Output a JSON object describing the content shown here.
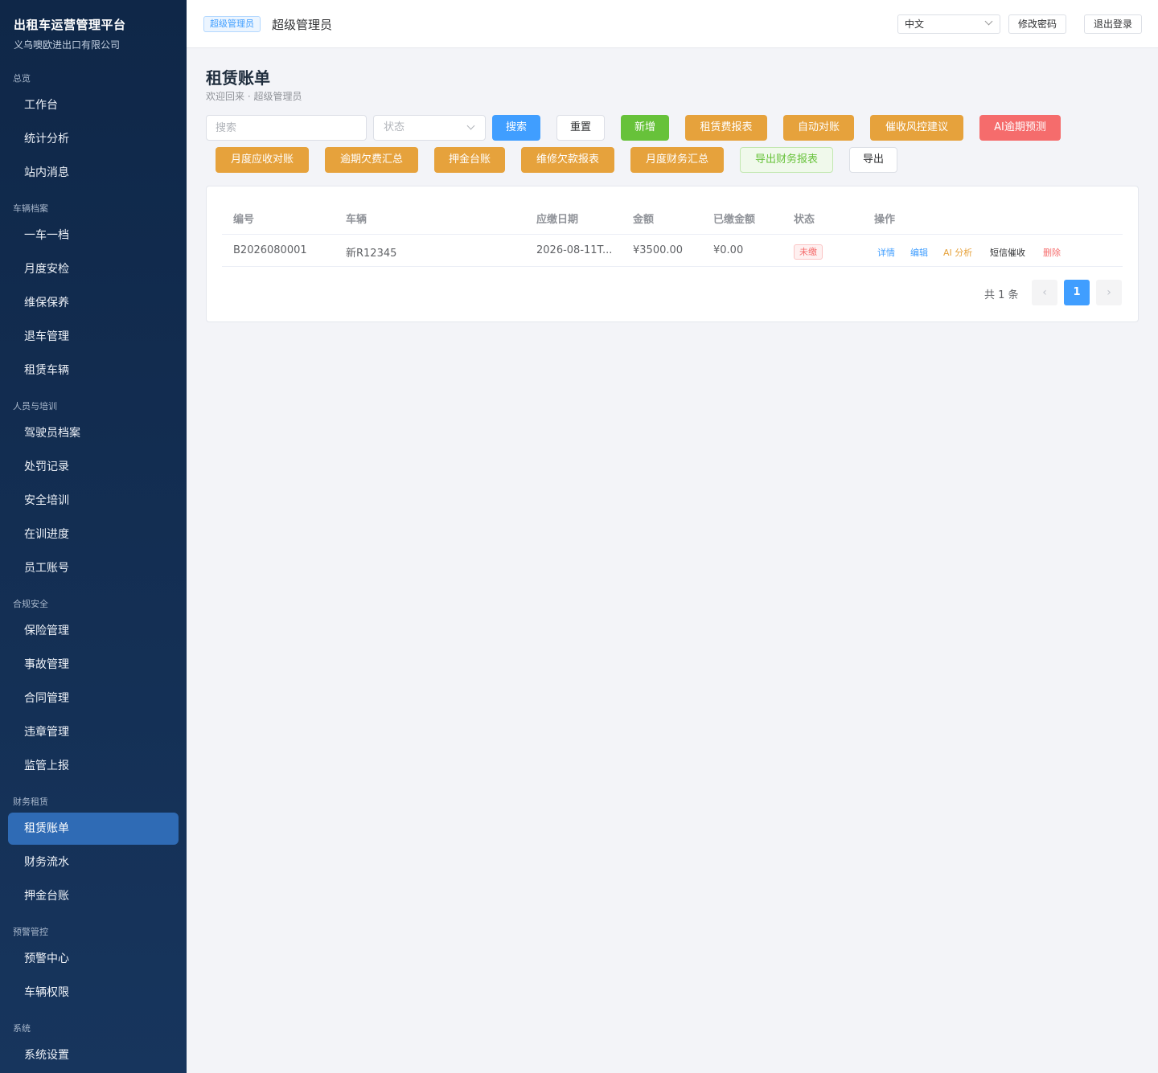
{
  "sidebar": {
    "brand_title": "出租车运营管理平台",
    "brand_subtitle": "义乌噢欧进出口有限公司",
    "groups": {
      "overview": "总览",
      "vehicles": "车辆档案",
      "people": "人员与培训",
      "compliance": "合规安全",
      "finance": "财务租赁",
      "warning": "预警管控",
      "system": "系统"
    },
    "items": {
      "workbench": "工作台",
      "stats": "统计分析",
      "messages": "站内消息",
      "one_car_file": "一车一档",
      "monthly_inspection": "月度安检",
      "maintenance": "维保保养",
      "car_return": "退车管理",
      "rental_vehicles": "租赁车辆",
      "driver_files": "驾驶员档案",
      "penalties": "处罚记录",
      "safety_training": "安全培训",
      "training_progress": "在训进度",
      "staff_accounts": "员工账号",
      "insurance": "保险管理",
      "accidents": "事故管理",
      "contracts": "合同管理",
      "violations": "违章管理",
      "regulatory_report": "监管上报",
      "rental_bills": "租赁账单",
      "finance_flow": "财务流水",
      "deposit_ledger": "押金台账",
      "warning_center": "预警中心",
      "vehicle_permissions": "车辆权限",
      "system_settings": "系统设置"
    }
  },
  "topbar": {
    "role_tag": "超级管理员",
    "user_name": "超级管理员",
    "language": "中文",
    "change_password": "修改密码",
    "logout": "退出登录"
  },
  "page": {
    "title": "租赁账单",
    "subtitle": "欢迎回来 · 超级管理员"
  },
  "toolbar": {
    "search_placeholder": "搜索",
    "status_placeholder": "状态",
    "search": "搜索",
    "reset": "重置",
    "add": "新增",
    "rent_report": "租赁费报表",
    "auto_reconcile": "自动对账",
    "collection_risk": "催收风控建议",
    "ai_overdue": "AI逾期预测",
    "monthly_receivable": "月度应收对账",
    "overdue_summary": "逾期欠费汇总",
    "deposit_ledger": "押金台账",
    "repair_debt_report": "维修欠款报表",
    "monthly_finance": "月度财务汇总",
    "export_finance": "导出财务报表",
    "export": "导出"
  },
  "table": {
    "headers": {
      "id": "编号",
      "vehicle": "车辆",
      "due_date": "应缴日期",
      "amount": "金额",
      "paid": "已缴金额",
      "status": "状态",
      "actions": "操作"
    },
    "rows": [
      {
        "id": "B2026080001",
        "vehicle": "新R12345",
        "due_date": "2026-08-11T...",
        "amount": "¥3500.00",
        "paid": "¥0.00",
        "status": "未缴",
        "actions": {
          "detail": "详情",
          "edit": "编辑",
          "ai": "AI 分析",
          "sms": "短信催收",
          "delete": "删除"
        }
      }
    ]
  },
  "pagination": {
    "total": "共 1 条",
    "current": "1",
    "prev": "‹",
    "next": "›"
  },
  "colors": {
    "primary": "#409eff",
    "success": "#67c23a",
    "warning": "#e6a23c",
    "danger": "#f56c6c",
    "sidebar_bg": "#0f2748",
    "sidebar_active": "#2f6bb5"
  }
}
